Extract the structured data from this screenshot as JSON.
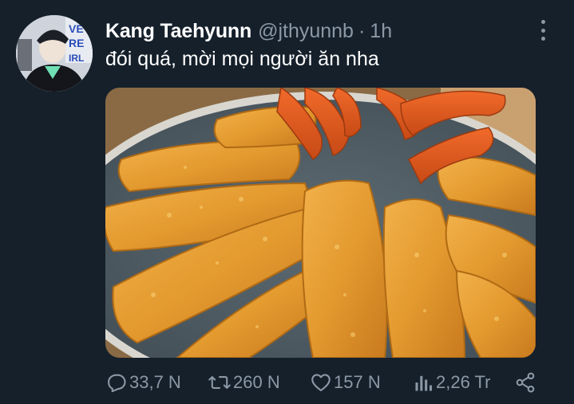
{
  "author": {
    "display_name": "Kang Taehyunn",
    "handle": "@jthyunnb",
    "separator": "·",
    "time": "1h"
  },
  "avatar_icon": "profile-photo",
  "tweet": {
    "text": "đói quá, mời mọi người ăn nha",
    "media_icon": "fried-shrimp-photo"
  },
  "actions": {
    "replies": "33,7 N",
    "retweets": "260 N",
    "likes": "157 N",
    "views": "2,26 Tr"
  },
  "icons": {
    "reply": "reply-icon",
    "retweet": "retweet-icon",
    "like": "heart-icon",
    "views": "views-chart-icon",
    "share": "share-icon",
    "more": "more-vertical-icon"
  },
  "colors": {
    "background": "#15202b",
    "primary_text": "#ffffff",
    "secondary_text": "#8b98a5"
  }
}
